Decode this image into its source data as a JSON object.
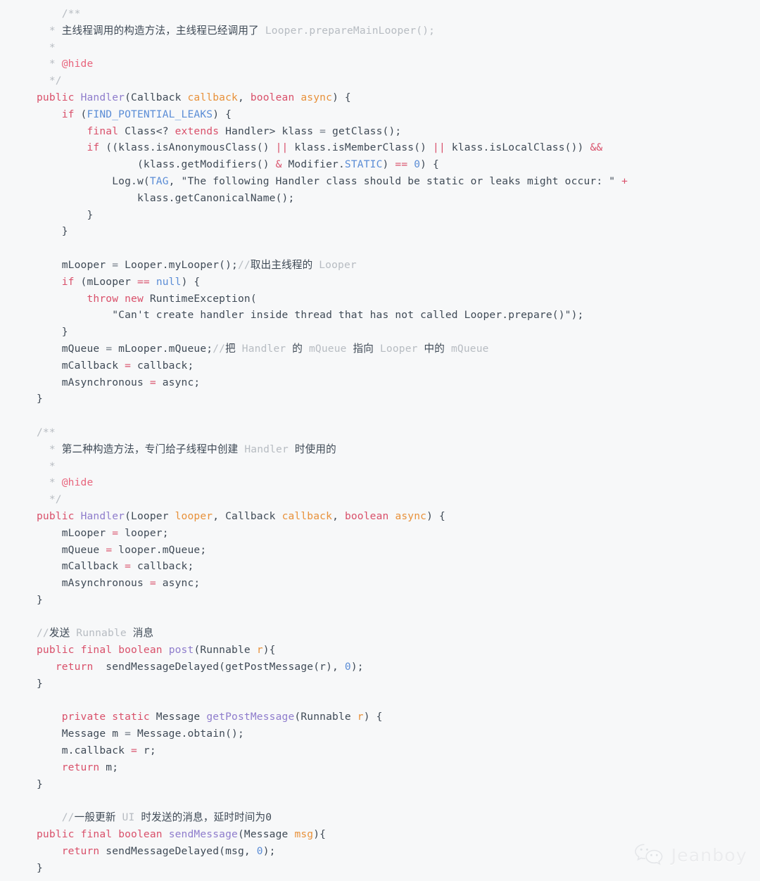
{
  "document": {
    "kind": "source-code-screenshot",
    "language": "Java",
    "background_color": "#f7f8f9",
    "colors": {
      "text": "#3f4a56",
      "keyword": "#d9506a",
      "type": "#8e7ccc",
      "parameter": "#e8913a",
      "constant": "#5b8dd6",
      "comment": "#b7bcc2",
      "annotation": "#e8647c"
    }
  },
  "code": {
    "lines": [
      "    /**",
      "  * 主线程调用的构造方法，主线程已经调用了 Looper.prepareMainLooper();",
      "  *",
      "  * @hide",
      "  */",
      "public Handler(Callback callback, boolean async) {",
      "    if (FIND_POTENTIAL_LEAKS) {",
      "        final Class<? extends Handler> klass = getClass();",
      "        if ((klass.isAnonymousClass() || klass.isMemberClass() || klass.isLocalClass()) &&",
      "                (klass.getModifiers() & Modifier.STATIC) == 0) {",
      "            Log.w(TAG, \"The following Handler class should be static or leaks might occur: \" +",
      "                klass.getCanonicalName());",
      "        }",
      "    }",
      "",
      "    mLooper = Looper.myLooper();//取出主线程的 Looper",
      "    if (mLooper == null) {",
      "        throw new RuntimeException(",
      "            \"Can't create handler inside thread that has not called Looper.prepare()\");",
      "    }",
      "    mQueue = mLooper.mQueue;//把 Handler 的 mQueue 指向 Looper 中的 mQueue",
      "    mCallback = callback;",
      "    mAsynchronous = async;",
      "}",
      "",
      "/**",
      "  * 第二种构造方法，专门给子线程中创建 Handler 时使用的",
      "  *",
      "  * @hide",
      "  */",
      "public Handler(Looper looper, Callback callback, boolean async) {",
      "    mLooper = looper;",
      "    mQueue = looper.mQueue;",
      "    mCallback = callback;",
      "    mAsynchronous = async;",
      "}",
      "",
      "//发送 Runnable 消息",
      "public final boolean post(Runnable r){",
      "   return  sendMessageDelayed(getPostMessage(r), 0);",
      "}",
      "",
      "    private static Message getPostMessage(Runnable r) {",
      "    Message m = Message.obtain();",
      "    m.callback = r;",
      "    return m;",
      "}",
      "",
      "    //一般更新 UI 时发送的消息，延时时间为0",
      "public final boolean sendMessage(Message msg){",
      "    return sendMessageDelayed(msg, 0);",
      "}"
    ]
  },
  "watermark": {
    "label": "Jeanboy",
    "icon": "wechat-logo-icon"
  }
}
